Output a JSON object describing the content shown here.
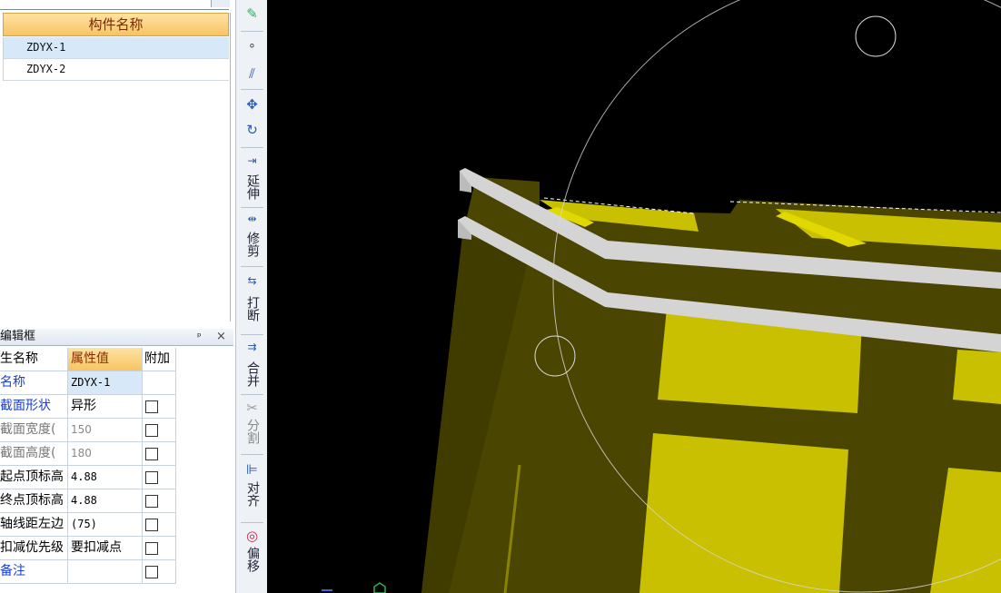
{
  "component_list": {
    "header": "构件名称",
    "rows": [
      "ZDYX-1",
      "ZDYX-2"
    ]
  },
  "property_panel": {
    "title": "编辑框",
    "pin": "ᴘ",
    "close": "×",
    "col_name": "生名称",
    "col_value": "属性值",
    "col_add": "附加",
    "rows": [
      {
        "name": "名称",
        "value": "ZDYX-1",
        "checkbox": false
      },
      {
        "name": "截面形状",
        "value": "异形",
        "checkbox": true
      },
      {
        "name": "截面宽度(",
        "value": "150",
        "checkbox": true
      },
      {
        "name": "截面高度(",
        "value": "180",
        "checkbox": true
      },
      {
        "name": "起点顶标高",
        "value": "4.88",
        "checkbox": true
      },
      {
        "name": "终点顶标高",
        "value": "4.88",
        "checkbox": true
      },
      {
        "name": "轴线距左边",
        "value": "(75)",
        "checkbox": true
      },
      {
        "name": "扣减优先级",
        "value": "要扣减点",
        "checkbox": true
      },
      {
        "name": "备注",
        "value": "",
        "checkbox": true
      }
    ]
  },
  "toolbar": {
    "extend": "延伸",
    "trim": "修剪",
    "break": "打断",
    "merge": "合并",
    "split": "分割",
    "align": "对齐",
    "offset": "偏移"
  },
  "colors": {
    "viewport_bg": "#000000",
    "olive": "#4a4500",
    "yellow": "#c8c000",
    "beam_gray": "#d4d4d4"
  }
}
